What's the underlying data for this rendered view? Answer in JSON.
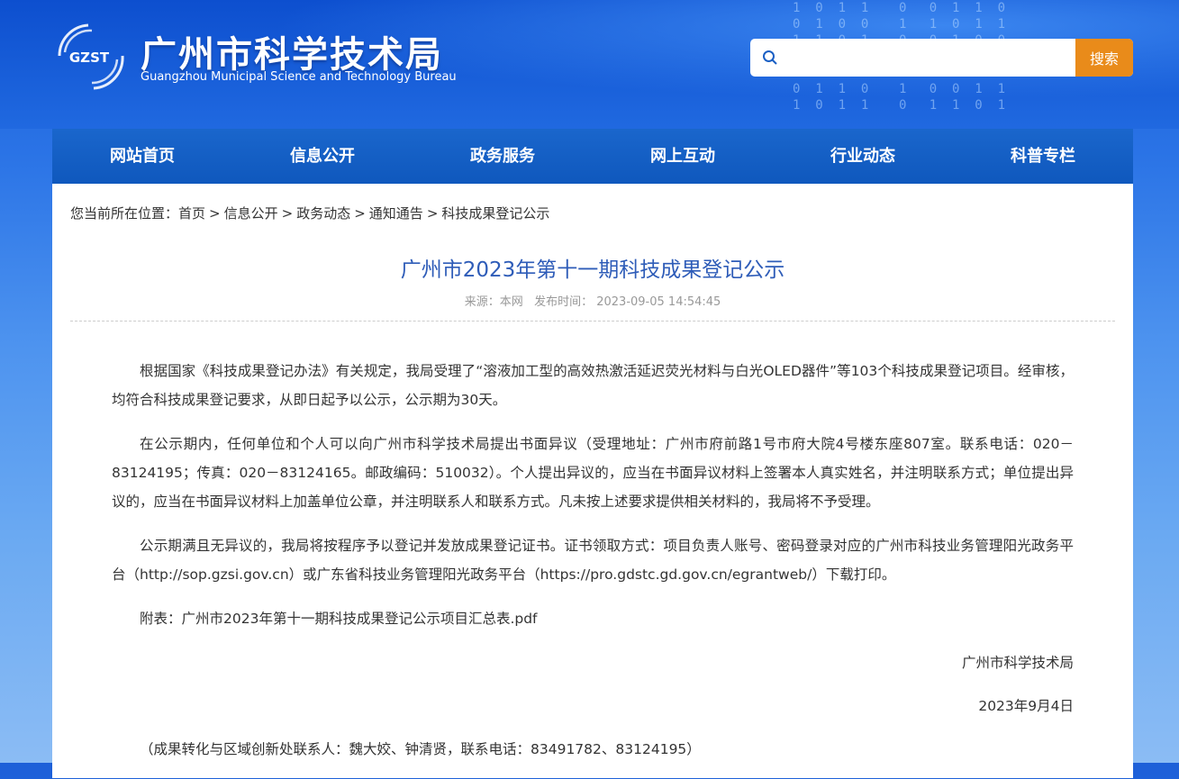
{
  "header": {
    "logo_text": "GZST",
    "title": "广州市科学技术局",
    "subtitle": "Guangzhou Municipal Science and Technology Bureau",
    "search_placeholder": "",
    "search_button": "搜索"
  },
  "nav": [
    "网站首页",
    "信息公开",
    "政务服务",
    "网上互动",
    "行业动态",
    "科普专栏"
  ],
  "breadcrumb": {
    "prefix": "您当前所在位置：",
    "items": [
      "首页",
      "信息公开",
      "政务动态",
      "通知通告",
      "科技成果登记公示"
    ],
    "separator": ">"
  },
  "article": {
    "title": "广州市2023年第十一期科技成果登记公示",
    "source": "来源：本网",
    "published": "发布时间： 2023-09-05 14:54:45",
    "paragraphs": [
      "根据国家《科技成果登记办法》有关规定，我局受理了“溶液加工型的高效热激活延迟荧光材料与白光OLED器件”等103个科技成果登记项目。经审核，均符合科技成果登记要求，从即日起予以公示，公示期为30天。",
      "在公示期内，任何单位和个人可以向广州市科学技术局提出书面异议（受理地址：广州市府前路1号市府大院4号楼东座807室。联系电话：020－83124195；传真：020－83124165。邮政编码：510032）。个人提出异议的，应当在书面异议材料上签署本人真实姓名，并注明联系方式；单位提出异议的，应当在书面异议材料上加盖单位公章，并注明联系人和联系方式。凡未按上述要求提供相关材料的，我局将不予受理。",
      "公示期满且无异议的，我局将按程序予以登记并发放成果登记证书。证书领取方式：项目负责人账号、密码登录对应的广州市科技业务管理阳光政务平台（http://sop.gzsi.gov.cn）或广东省科技业务管理阳光政务平台（https://pro.gdstc.gd.gov.cn/egrantweb/）下载打印。"
    ],
    "attachment": "附表：广州市2023年第十一期科技成果登记公示项目汇总表.pdf",
    "signature": "广州市科学技术局",
    "date": "2023年9月4日",
    "contact": "（成果转化与区域创新处联系人：魏大姣、钟清贤，联系电话：83491782、83124195）"
  }
}
